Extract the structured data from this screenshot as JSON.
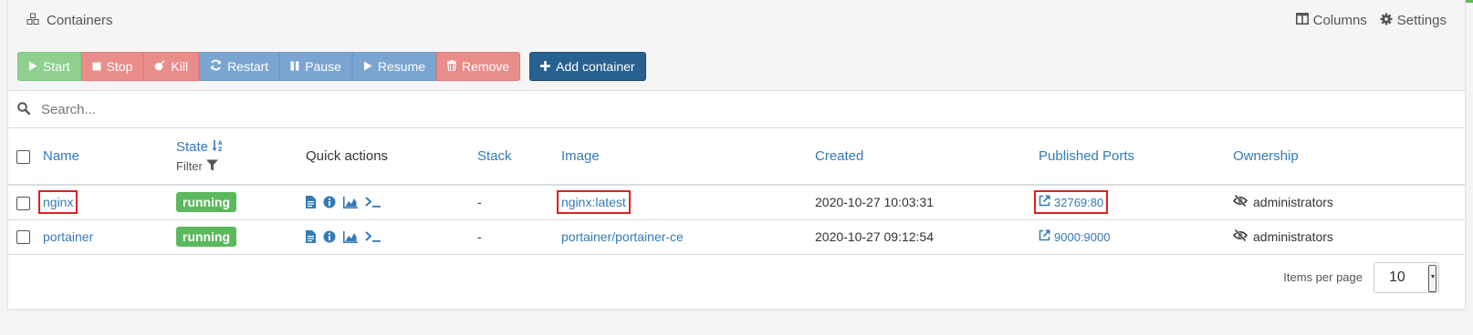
{
  "header": {
    "title": "Containers",
    "columns_label": "Columns",
    "settings_label": "Settings"
  },
  "toolbar": {
    "start": "Start",
    "stop": "Stop",
    "kill": "Kill",
    "restart": "Restart",
    "pause": "Pause",
    "resume": "Resume",
    "remove": "Remove",
    "add": "Add container"
  },
  "search": {
    "placeholder": "Search..."
  },
  "table": {
    "headers": {
      "name": "Name",
      "state": "State",
      "filter": "Filter",
      "quick_actions": "Quick actions",
      "stack": "Stack",
      "image": "Image",
      "created": "Created",
      "ports": "Published Ports",
      "ownership": "Ownership"
    },
    "rows": [
      {
        "name": "nginx",
        "state": "running",
        "stack": "-",
        "image": "nginx:latest",
        "created": "2020-10-27 10:03:31",
        "port": "32769:80",
        "ownership": "administrators"
      },
      {
        "name": "portainer",
        "state": "running",
        "stack": "-",
        "image": "portainer/portainer-ce",
        "created": "2020-10-27 09:12:54",
        "port": "9000:9000",
        "ownership": "administrators"
      }
    ]
  },
  "footer": {
    "items_per_page_label": "Items per page",
    "items_per_page_value": "10"
  },
  "colors": {
    "accent": "#337ab7",
    "success": "#5cb85c",
    "danger": "#d9534f",
    "primary": "#286090",
    "highlight": "#e02020"
  }
}
